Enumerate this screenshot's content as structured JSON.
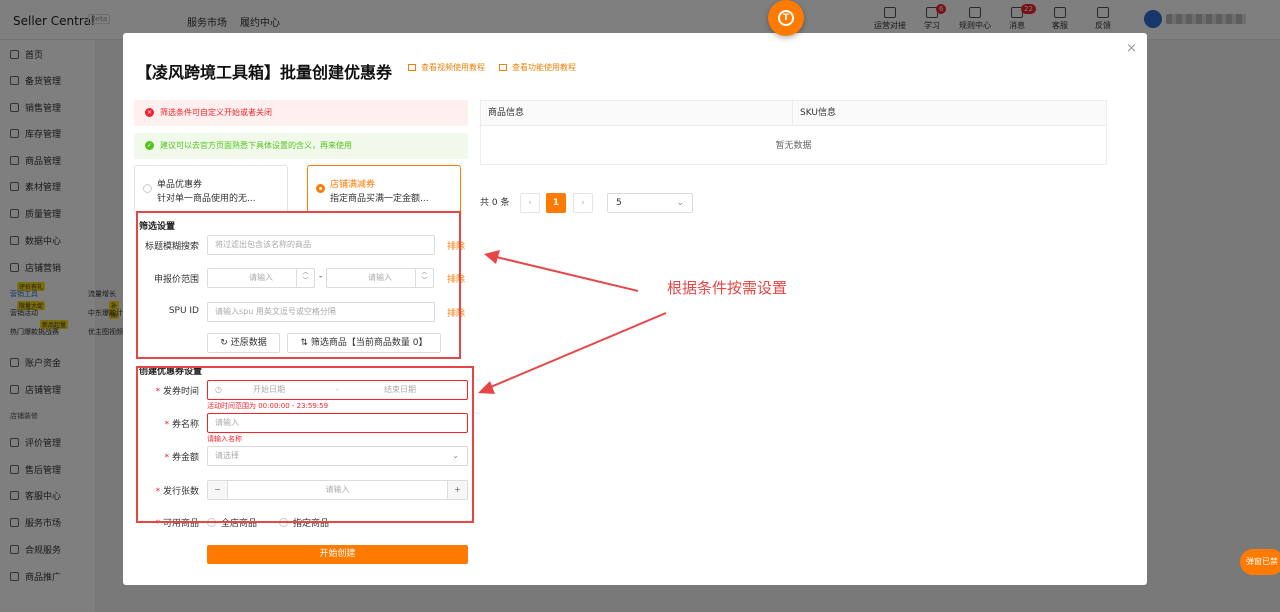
{
  "app": {
    "brand": "Seller Central",
    "beta": "Beta",
    "nav": [
      "服务市场",
      "履约中心"
    ]
  },
  "topbar": [
    {
      "label": "运营对接",
      "badge": ""
    },
    {
      "label": "学习",
      "badge": "6"
    },
    {
      "label": "规则中心",
      "badge": ""
    },
    {
      "label": "消息",
      "badge": "22"
    },
    {
      "label": "客服",
      "badge": ""
    },
    {
      "label": "反馈",
      "badge": ""
    }
  ],
  "sidebar": {
    "items": [
      "首页",
      "备货管理",
      "销售管理",
      "库存管理",
      "商品管理",
      "素材管理",
      "质量管理",
      "数据中心",
      "店铺营销"
    ],
    "sub": [
      "营销工具",
      "流量增长",
      "营销活动",
      "中东爆款计划",
      "热门爆款挑战赛",
      "优主图视频"
    ],
    "tags": [
      "评价有礼",
      "限量大促",
      "补贴",
      "新品起量"
    ],
    "items2": [
      "账户资金",
      "店铺管理"
    ],
    "group": "店铺装修",
    "items3": [
      "评价管理",
      "售后管理",
      "客服中心",
      "服务市场",
      "合规服务",
      "商品推广"
    ]
  },
  "logo_letter": "T",
  "modal": {
    "title": "【凌风跨境工具箱】批量创建优惠券",
    "link_video": "查看视频使用教程",
    "link_doc": "查看功能使用教程",
    "close": "×",
    "alert_error": "筛选条件可自定义开始或者关闭",
    "alert_success": "建议可以去官方页面熟悉下具体设置的含义，再来使用",
    "coupon_types": [
      {
        "title": "单品优惠券",
        "desc": "针对单一商品使用的无..."
      },
      {
        "title": "店铺满减券",
        "desc": "指定商品买满一定金额..."
      }
    ],
    "filter": {
      "section": "筛选设置",
      "title_label": "标题模糊搜索",
      "title_placeholder": "将过滤出包含该名称的商品",
      "price_label": "申报价范围",
      "price_placeholder": "请输入",
      "dash": "-",
      "spu_label": "SPU ID",
      "spu_placeholder": "请输入spu 用英文逗号或空格分隔",
      "exclude": "排除",
      "reset": "还原数据",
      "filter_btn": "筛选商品【当前商品数量 0】"
    },
    "create": {
      "section": "创建优惠券设置",
      "time_label": "发券时间",
      "start": "开始日期",
      "end": "结束日期",
      "time_tip": "活动时间范围为 00:00:00 - 23:59:59",
      "name_label": "券名称",
      "name_placeholder": "请输入",
      "name_error": "请输入名称",
      "amount_label": "券金额",
      "amount_placeholder": "请选择",
      "count_label": "发行张数",
      "count_placeholder": "请输入",
      "usable_label": "可用商品",
      "usable_options": [
        "全店商品",
        "指定商品"
      ],
      "submit": "开始创建"
    },
    "table": {
      "cols": [
        "商品信息",
        "SKU信息"
      ],
      "empty": "暂无数据"
    },
    "pager": {
      "total": "共 0 条",
      "page": "1",
      "size": "5"
    }
  },
  "annotation": "根据条件按需设置",
  "popup_btn": "弹窗已禁"
}
